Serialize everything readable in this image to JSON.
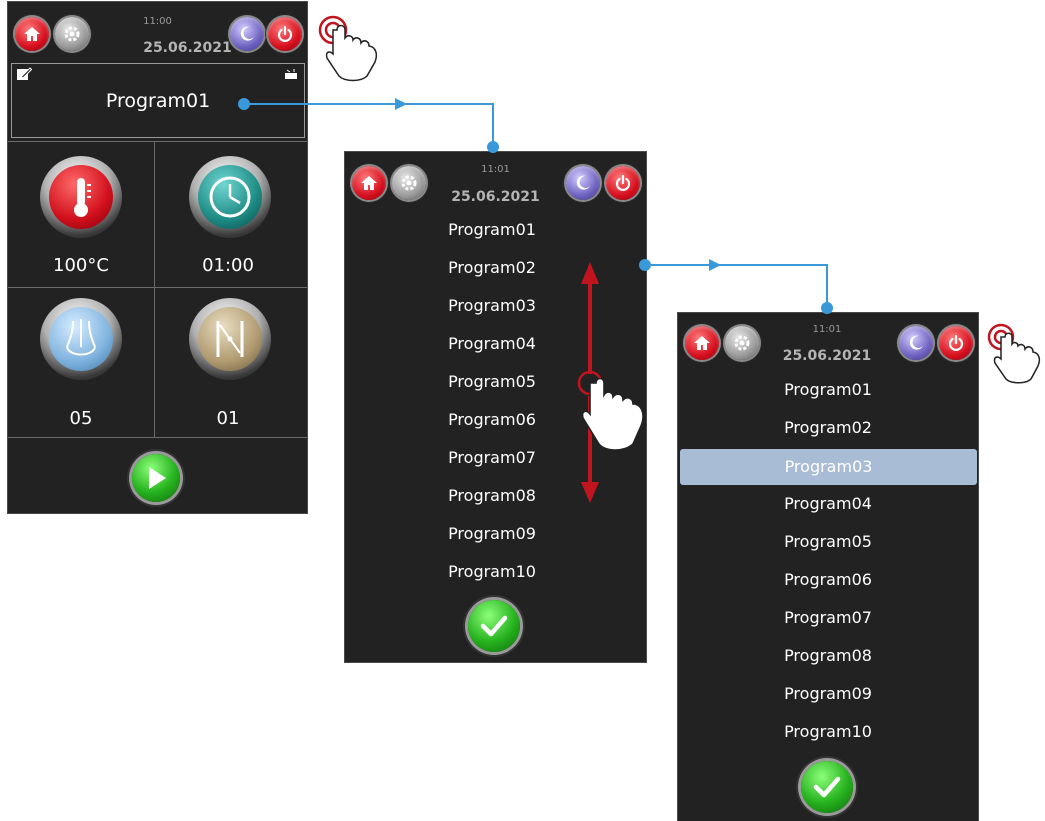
{
  "screen1": {
    "time": "11:00",
    "date": "25.06.2021",
    "program_name": "Program01",
    "tiles": {
      "temperature": "100°C",
      "timer": "01:00",
      "steam": "05",
      "flap": "01"
    }
  },
  "screen2": {
    "time": "11:01",
    "date": "25.06.2021",
    "programs": [
      "Program01",
      "Program02",
      "Program03",
      "Program04",
      "Program05",
      "Program06",
      "Program07",
      "Program08",
      "Program09",
      "Program10"
    ]
  },
  "screen3": {
    "time": "11:01",
    "date": "25.06.2021",
    "programs": [
      "Program01",
      "Program02",
      "Program03",
      "Program04",
      "Program05",
      "Program06",
      "Program07",
      "Program08",
      "Program09",
      "Program10"
    ],
    "selected": "Program03"
  },
  "colors": {
    "screen_bg": "#222222",
    "selection": "#a9bcd5",
    "connector": "#3a9ad9",
    "scroll_arrow": "#c0151f",
    "accent_red": "#d60f1e",
    "accent_green": "#26b21e"
  }
}
